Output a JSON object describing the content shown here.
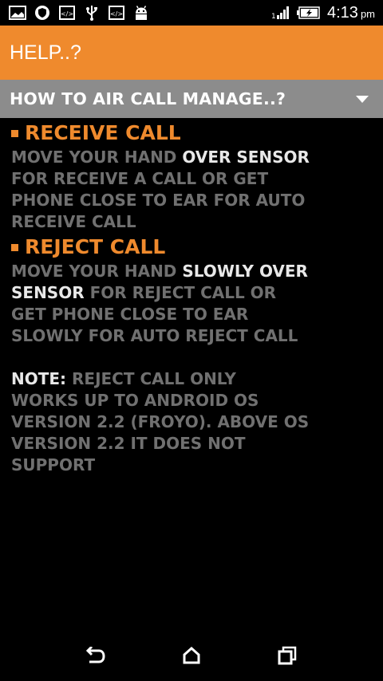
{
  "status_bar": {
    "icons_left": [
      "gallery-icon",
      "shield-icon",
      "code-icon",
      "usb-icon",
      "code-icon",
      "android-icon"
    ],
    "icons_right": [
      "signal-icon",
      "battery-charging-icon"
    ],
    "time": "4:13",
    "ampm": "pm"
  },
  "app_bar": {
    "title": "HELP..?"
  },
  "spinner": {
    "selected": "HOW TO AIR CALL MANAGE..?"
  },
  "content": {
    "receive": {
      "heading": "RECEIVE CALL",
      "lines": [
        {
          "pre": "MOVE YOUR HAND ",
          "hl": "OVER SENSOR"
        },
        {
          "pre": "FOR RECEIVE A CALL OR GET"
        },
        {
          "pre": "PHONE CLOSE TO EAR FOR AUTO"
        },
        {
          "pre": "RECEIVE CALL"
        }
      ]
    },
    "reject": {
      "heading": "REJECT CALL",
      "lines": [
        {
          "pre": "MOVE YOUR HAND ",
          "hl": "SLOWLY OVER"
        },
        {
          "hl_first": "SENSOR",
          "post": " FOR REJECT CALL OR"
        },
        {
          "pre": "GET PHONE CLOSE TO EAR"
        },
        {
          "pre": "SLOWLY FOR AUTO REJECT CALL"
        }
      ]
    },
    "note": {
      "label": "NOTE:",
      "line1": " REJECT CALL ONLY",
      "line2": "WORKS UP TO ANDROID OS",
      "line3": "VERSION 2.2 (FROYO). ABOVE OS",
      "line4": "VERSION 2.2 IT DOES NOT",
      "line5": "SUPPORT"
    }
  },
  "nav_bar": {
    "buttons": [
      "back-icon",
      "home-icon",
      "recents-icon"
    ]
  },
  "colors": {
    "accent": "#ef8a2d",
    "spinner_bg": "#8c8c8c",
    "body_text": "#707070",
    "highlight_text": "#e8e8e8"
  }
}
